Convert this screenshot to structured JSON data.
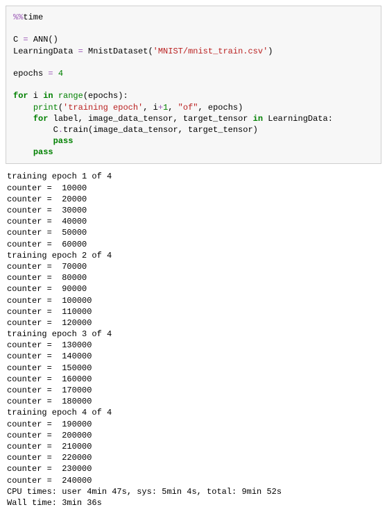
{
  "code": {
    "l1_magic": "%%",
    "l1_time": "time",
    "l3_C": "C ",
    "l3_eq": "=",
    "l3_sp": " ",
    "l3_ANN": "ANN()",
    "l4_var": "LearningData ",
    "l4_eq": "=",
    "l4_sp": " MnistDataset(",
    "l4_str": "'MNIST/mnist_train.csv'",
    "l4_close": ")",
    "l6_var": "epochs ",
    "l6_eq": "=",
    "l6_sp": " ",
    "l6_num": "4",
    "l8_for": "for",
    "l8_mid": " i ",
    "l8_in": "in",
    "l8_sp": " ",
    "l8_range": "range",
    "l8_open": "(epochs):",
    "l9_indent": "    ",
    "l9_print": "print",
    "l9_open": "(",
    "l9_str1": "'training epoch'",
    "l9_mid1": ", i",
    "l9_plus": "+",
    "l9_one": "1",
    "l9_mid2": ", ",
    "l9_str2": "\"of\"",
    "l9_mid3": ", epochs)",
    "l10_indent": "    ",
    "l10_for": "for",
    "l10_mid": " label, image_data_tensor, target_tensor ",
    "l10_in": "in",
    "l10_rest": " LearningData:",
    "l11_indent": "        C",
    "l11_dot": ".",
    "l11_call": "train(image_data_tensor, target_tensor)",
    "l12_indent": "        ",
    "l12_pass": "pass",
    "l13_indent": "    ",
    "l13_pass": "pass"
  },
  "output_lines": [
    "training epoch 1 of 4",
    "counter =  10000",
    "counter =  20000",
    "counter =  30000",
    "counter =  40000",
    "counter =  50000",
    "counter =  60000",
    "training epoch 2 of 4",
    "counter =  70000",
    "counter =  80000",
    "counter =  90000",
    "counter =  100000",
    "counter =  110000",
    "counter =  120000",
    "training epoch 3 of 4",
    "counter =  130000",
    "counter =  140000",
    "counter =  150000",
    "counter =  160000",
    "counter =  170000",
    "counter =  180000",
    "training epoch 4 of 4",
    "counter =  190000",
    "counter =  200000",
    "counter =  210000",
    "counter =  220000",
    "counter =  230000",
    "counter =  240000",
    "CPU times: user 4min 47s, sys: 5min 4s, total: 9min 52s",
    "Wall time: 3min 36s"
  ]
}
